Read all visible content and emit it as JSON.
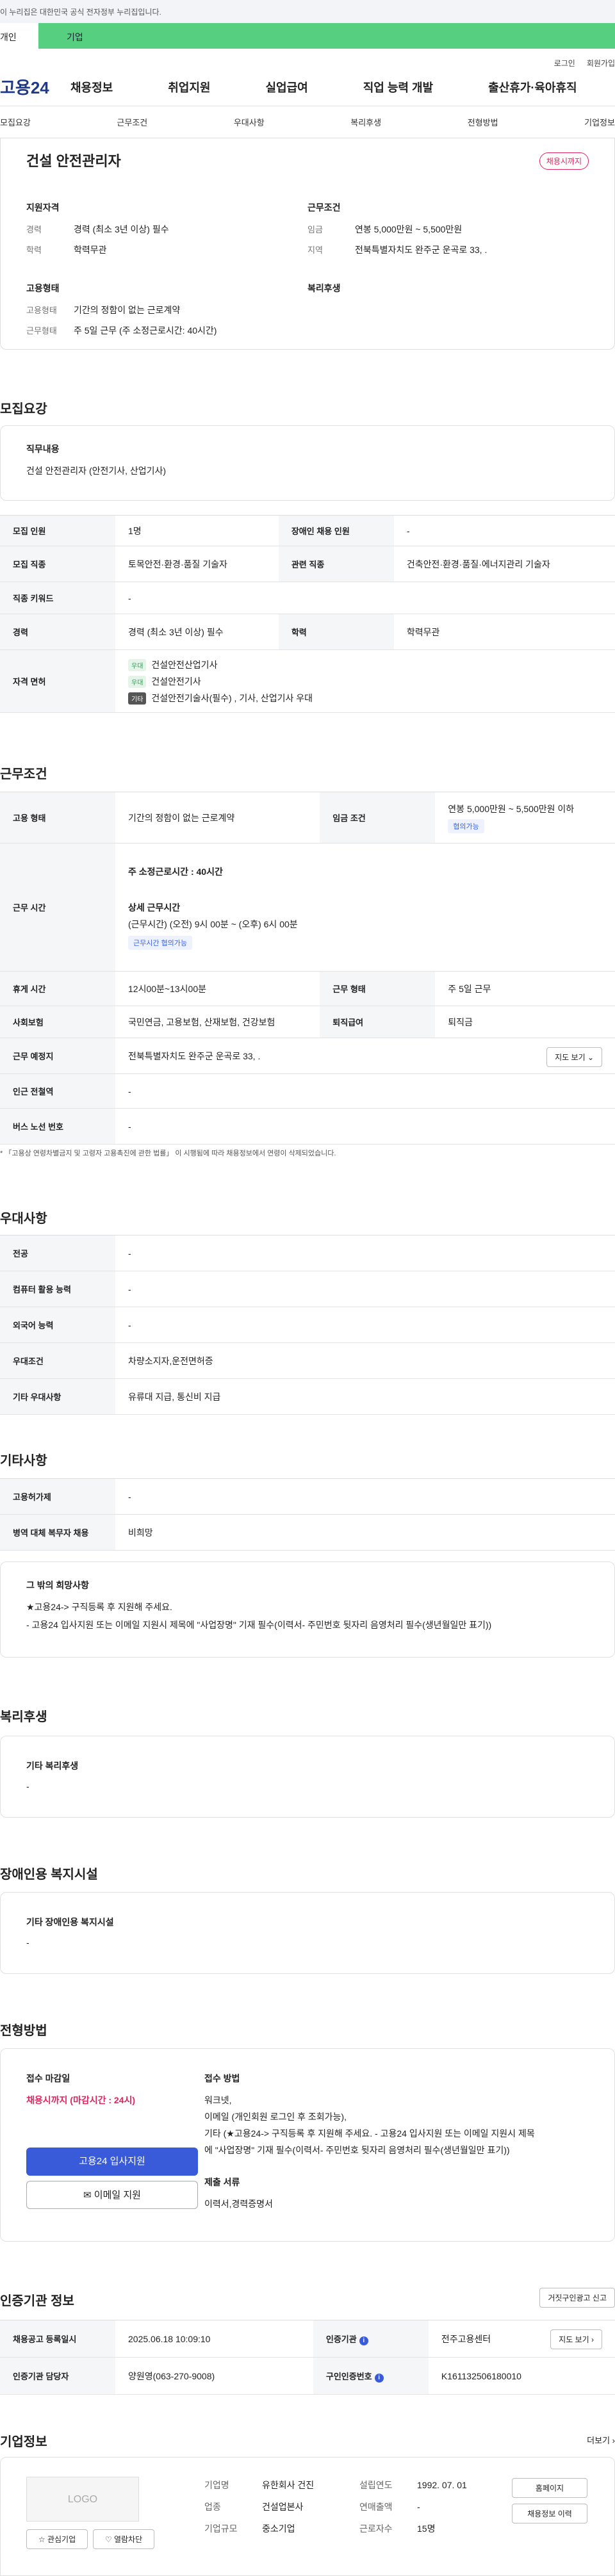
{
  "topbar": {
    "notice": "이 누리집은 대한민국 공식 전자정부 누리집입니다."
  },
  "tabs": {
    "individual": "개인",
    "business": "기업"
  },
  "util": {
    "login": "로그인",
    "join": "회원가입"
  },
  "gnb": {
    "logo": "고용24",
    "items": [
      "채용정보",
      "취업지원",
      "실업급여",
      "직업 능력 개발",
      "출산휴가·육아휴직"
    ]
  },
  "anchors": [
    "모집요강",
    "근무조건",
    "우대사항",
    "복리후생",
    "전형방법",
    "기업정보"
  ],
  "summary": {
    "title": "건설 안전관리자",
    "badge": "채용시까지",
    "qual_h": "지원자격",
    "career_k": "경력",
    "career_v": "경력 (최소 3년 이상) 필수",
    "edu_k": "학력",
    "edu_v": "학력무관",
    "cond_h": "근무조건",
    "wage_k": "임금",
    "wage_v": "연봉 5,000만원 ~ 5,500만원",
    "loc_k": "지역",
    "loc_v": "전북특별자치도 완주군 운곡로 33, .",
    "emp_h": "고용형태",
    "type_k": "고용형태",
    "type_v": "기간의 정함이 없는 근로계약",
    "work_k": "근무형태",
    "work_v": "주 5일 근무 (주 소정근로시간: 40시간)",
    "welfare_h": "복리후생"
  },
  "recruit": {
    "section": "모집요강",
    "job_h": "직무내용",
    "job_v": "건설 안전관리자 (안전기사, 산업기사)",
    "rows": {
      "count_k": "모집 인원",
      "count_v": "1명",
      "disabled_k": "장애인 채용 인원",
      "disabled_v": "-",
      "occupation_k": "모집 직종",
      "occupation_v": "토목안전·환경·품질 기술자",
      "related_k": "관련 직종",
      "related_v": "건축안전·환경·품질·에너지관리 기술자",
      "keyword_k": "직종 키워드",
      "keyword_v": "-",
      "career_k": "경력",
      "career_v": "경력 (최소 3년 이상) 필수",
      "edu_k": "학력",
      "edu_v": "학력무관",
      "license_k": "자격 면허",
      "lic1_tag": "우대",
      "lic1": "건설안전산업기사",
      "lic2_tag": "우대",
      "lic2": "건설안전기사",
      "lic3_tag": "기타",
      "lic3": "건설안전기술사(필수) , 기사, 산업기사 우대"
    }
  },
  "cond": {
    "section": "근무조건",
    "type_k": "고용 형태",
    "type_v": "기간의 정함이 없는 근로계약",
    "wage_k": "임금 조건",
    "wage_v": "연봉 5,000만원 ~ 5,500만원 이하",
    "wage_tag": "협의가능",
    "hours_k": "근무 시간",
    "hours_week": "주 소정근로시간 : 40시간",
    "hours_detail_h": "상세 근무시간",
    "hours_detail": "(근무시간) (오전) 9시 00분 ~ (오후) 6시 00분",
    "hours_tag": "근무시간 협의가능",
    "rest_k": "휴게 시간",
    "rest_v": "12시00분~13시00분",
    "form_k": "근무 형태",
    "form_v": "주 5일 근무",
    "ins_k": "사회보험",
    "ins_v": "국민연금, 고용보험, 산재보험, 건강보험",
    "sev_k": "퇴직급여",
    "sev_v": "퇴직금",
    "place_k": "근무 예정지",
    "place_v": "전북특별자치도 완주군 운곡로 33, .",
    "map_btn": "지도 보기 ⌄",
    "subway_k": "인근 전철역",
    "subway_v": "-",
    "bus_k": "버스 노선 번호",
    "bus_v": "-",
    "note": "* 「고용상 연령차별금지 및 고령자 고용촉진에 관한 법률」 이 시행됨에 따라 채용정보에서 연령이 삭제되었습니다."
  },
  "pref": {
    "section": "우대사항",
    "major_k": "전공",
    "major_v": "-",
    "pc_k": "컴퓨터 활용 능력",
    "pc_v": "-",
    "lang_k": "외국어 능력",
    "lang_v": "-",
    "cond_k": "우대조건",
    "cond_v": "차량소지자,운전면허증",
    "etc_k": "기타 우대사항",
    "etc_v": "유류대 지급, 통신비 지급"
  },
  "etc": {
    "section": "기타사항",
    "type_k": "고용허가제",
    "type_v": "-",
    "mil_k": "병역 대체 복무자 채용",
    "mil_v": "비희망",
    "wish_h": "그 밖의 희망사항",
    "wish1": "★고용24-> 구직등록 후 지원해 주세요.",
    "wish2": "- 고용24 입사지원 또는  이메일 지원시 제목에 \"사업장명\" 기재 필수(이력서-  주민번호 뒷자리 음영처리 필수(생년월일만 표기))"
  },
  "welfare": {
    "section": "복리후생",
    "h": "기타 복리후생",
    "v": "-"
  },
  "facility": {
    "section": "장애인용 복지시설",
    "h": "기타 장애인용 복지시설",
    "v": "-"
  },
  "screening": {
    "section": "전형방법",
    "deadline_h": "접수 마감일",
    "deadline_v": "채용시까지 (마감시간 : 24시)",
    "apply_btn": "고용24 입사지원",
    "email_btn": "✉ 이메일 지원",
    "method_h": "접수 방법",
    "m1": "워크넷,",
    "m2": "이메일 (개인회원 로그인 후 조회가능),",
    "m3": "기타 (★고용24-> 구직등록 후 지원해 주세요. - 고용24 입사지원 또는  이메일 지원시 제목",
    "m4": "에 \"사업장명\" 기재 필수(이력서-  주민번호 뒷자리 음영처리 필수(생년월일만 표기))",
    "docs_h": "제출 서류",
    "docs_v": "이력서,경력증명서"
  },
  "agency": {
    "section": "인증기관 정보",
    "report_btn": "거짓구인광고 신고",
    "reg_k": "채용공고 등록일시",
    "reg_v": "2025.06.18 10:09:10",
    "org_k": "인증기관",
    "org_v": "전주고용센터",
    "map_btn": "지도 보기 ›",
    "mgr_k": "인증기관 담당자",
    "mgr_v": "양원영(063-270-9008)",
    "id_k": "구인인증번호",
    "id_v": "K161132506180010"
  },
  "company": {
    "section": "기업정보",
    "more": "더보기 ›",
    "logo": "LOGO",
    "name_k": "기업명",
    "name_v": "유한회사 건진",
    "ind_k": "업종",
    "ind_v": "건설업본사",
    "size_k": "기업규모",
    "size_v": "중소기업",
    "est_k": "설립연도",
    "est_v": "1992. 07. 01",
    "sales_k": "연매출액",
    "sales_v": "-",
    "emp_k": "근로자수",
    "emp_v": "15명",
    "home_btn": "홈페이지",
    "list_btn": "채용정보 이력",
    "fav_btn": "☆ 관심기업",
    "block_btn": "♡ 열람차단"
  },
  "colors": {
    "accent": "#3a5bd9",
    "brand_green": "#56d080",
    "badge_red": "#e0245e"
  }
}
